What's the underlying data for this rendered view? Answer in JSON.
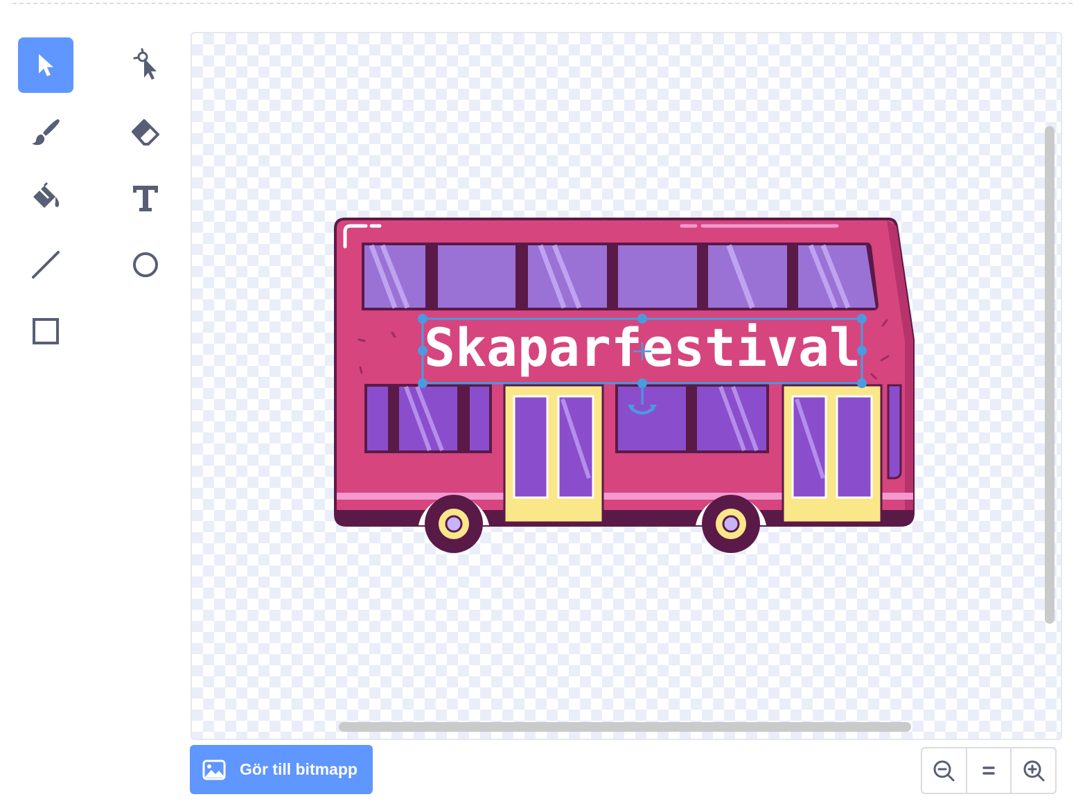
{
  "toolbar": {
    "tools": [
      {
        "name": "select",
        "icon": "select-arrow-icon",
        "active": true
      },
      {
        "name": "reshape",
        "icon": "reshape-icon",
        "active": false
      },
      {
        "name": "brush",
        "icon": "brush-icon",
        "active": false
      },
      {
        "name": "eraser",
        "icon": "eraser-icon",
        "active": false
      },
      {
        "name": "fill",
        "icon": "fill-bucket-icon",
        "active": false
      },
      {
        "name": "text",
        "icon": "text-icon",
        "active": false
      },
      {
        "name": "line",
        "icon": "line-icon",
        "active": false
      },
      {
        "name": "circle",
        "icon": "circle-icon",
        "active": false
      },
      {
        "name": "rectangle",
        "icon": "rectangle-icon",
        "active": false
      }
    ]
  },
  "canvas": {
    "text_object": "Skaparfestival"
  },
  "actions": {
    "convert_label": "Gör till bitmapp",
    "convert_icon": "image-icon"
  },
  "zoom": {
    "zoom_out_icon": "zoom-out-icon",
    "reset_icon": "zoom-reset-icon",
    "zoom_in_icon": "zoom-in-icon"
  },
  "colors": {
    "accent": "#5f96ff",
    "tool_icon": "#575e75",
    "bus_body": "#d6457e",
    "bus_dark": "#5a1a48",
    "window": "#9a72d6",
    "door": "#fae78a",
    "selection": "#4a9be0"
  }
}
